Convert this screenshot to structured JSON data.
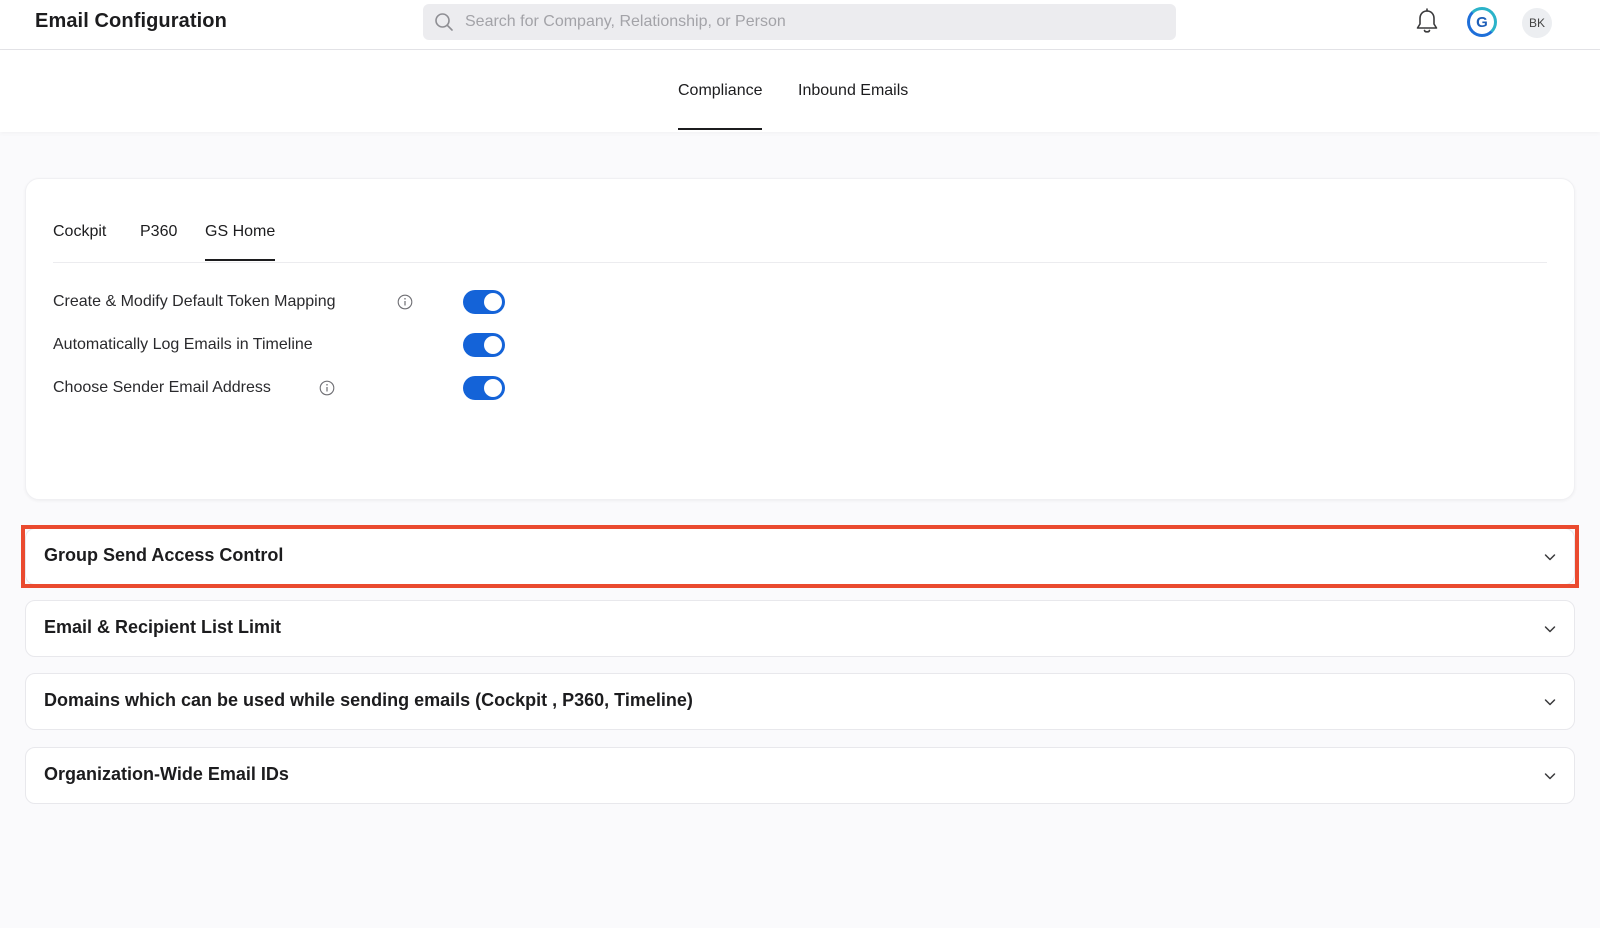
{
  "header": {
    "title": "Email Configuration",
    "search_placeholder": "Search for Company, Relationship, or Person",
    "avatar_initials": "BK",
    "brand_letter": "G"
  },
  "main_tabs": [
    {
      "label": "Compliance",
      "active": true
    },
    {
      "label": "Inbound Emails",
      "active": false
    }
  ],
  "sub_tabs": [
    {
      "label": "Cockpit",
      "active": false
    },
    {
      "label": "P360",
      "active": false
    },
    {
      "label": "GS Home",
      "active": true
    }
  ],
  "settings": [
    {
      "label": "Create & Modify Default Token Mapping",
      "has_info": true,
      "enabled": true
    },
    {
      "label": "Automatically Log Emails in Timeline",
      "has_info": false,
      "enabled": true
    },
    {
      "label": "Choose Sender Email Address",
      "has_info": true,
      "enabled": true
    }
  ],
  "accordions": [
    {
      "title": "Group Send Access Control",
      "highlighted": true
    },
    {
      "title": "Email & Recipient List Limit",
      "highlighted": false
    },
    {
      "title": "Domains which can be used while sending emails (Cockpit , P360, Timeline)",
      "highlighted": false
    },
    {
      "title": "Organization-Wide Email IDs",
      "highlighted": false
    }
  ],
  "colors": {
    "toggle_on": "#1463d8",
    "highlight_border": "#ea4a2f",
    "background": "#fafafc"
  },
  "icons": [
    "search-icon",
    "bell-icon",
    "info-icon",
    "chevron-down-icon"
  ]
}
